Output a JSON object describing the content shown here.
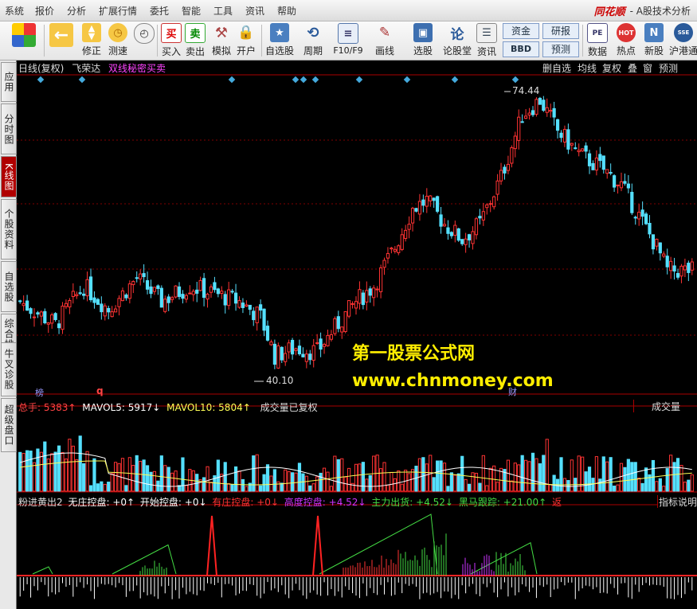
{
  "menu": [
    "系统",
    "报价",
    "分析",
    "扩展行情",
    "委托",
    "智能",
    "工具",
    "资讯",
    "帮助"
  ],
  "brand": {
    "logo": "同花顺",
    "title": "- A股技术分析"
  },
  "toolbar": [
    {
      "label": "",
      "icon": "layout-icon"
    },
    {
      "label": "",
      "icon": "back-arrow-icon"
    },
    {
      "label": "修正",
      "icon": "arrow-updown-icon"
    },
    {
      "label": "测速",
      "icon": "clock-icon"
    },
    {
      "label": "买入",
      "glyph": "买"
    },
    {
      "label": "卖出",
      "glyph": "卖"
    },
    {
      "label": "模拟",
      "icon": "hammer-icon"
    },
    {
      "label": "开户",
      "icon": "lock-icon"
    },
    {
      "label": "自选股",
      "icon": "star-folder-icon"
    },
    {
      "label": "周期",
      "icon": "cycle-icon"
    },
    {
      "label": "F10/F9",
      "icon": "doc-icon"
    },
    {
      "label": "画线",
      "icon": "pen-icon"
    },
    {
      "label": "选股",
      "icon": "screen-icon"
    },
    {
      "label": "论股堂",
      "glyph": "论"
    },
    {
      "label": "资讯",
      "icon": "news-icon"
    },
    {
      "label": "资金",
      "small": true
    },
    {
      "label": "BBD",
      "small": true
    },
    {
      "label": "研报",
      "small": true
    },
    {
      "label": "预测",
      "small": true
    },
    {
      "label": "数据",
      "glyph": "PE"
    },
    {
      "label": "热点",
      "glyph": "HOT"
    },
    {
      "label": "新股",
      "glyph": "N"
    },
    {
      "label": "沪港通",
      "glyph": "SSE"
    }
  ],
  "sidebar": [
    "应用",
    "分时图",
    "K线图",
    "个股资料",
    "自选股",
    "综合排名",
    "牛叉诊股",
    "超级盘口"
  ],
  "sidebar_active": 2,
  "header": {
    "period": "日线(复权)",
    "stock": "飞荣达",
    "formula": "双线秘密买卖"
  },
  "right_buttons": [
    "删自选",
    "均线",
    "复权",
    "叠",
    "窗",
    "预测"
  ],
  "price": {
    "high_label": "74.44",
    "low_label": "40.10",
    "high": 74.44,
    "low": 40.1
  },
  "markers": {
    "bang": "榜",
    "q": "q",
    "cai": "财"
  },
  "watermark": {
    "line1": "第一股票公式网",
    "line2": "www.chnmoney.com"
  },
  "volume_header": {
    "total": "总手: 5383↑",
    "ma5": "MAVOL5: 5917↓",
    "ma10": "MAVOL10: 5804↑",
    "note": "成交量已复权",
    "tab": "成交量"
  },
  "indicator_header": {
    "name": "粉进黄出2",
    "items": [
      {
        "text": "无庄控盘: +0↑",
        "color": "#ffffff"
      },
      {
        "text": "开始控盘: +0↓",
        "color": "#ffffff"
      },
      {
        "text": "有庄控盘: +0↓",
        "color": "#ff3333"
      },
      {
        "text": "高度控盘: +4.52↓",
        "color": "#cc33ff"
      },
      {
        "text": "主力出货: +4.52↓",
        "color": "#44dd44"
      },
      {
        "text": "黑马跟踪: +21.00↑",
        "color": "#44dd44"
      },
      {
        "text": "返",
        "color": "#ff3333"
      }
    ],
    "tab": "指标说明"
  },
  "colors": {
    "up": "#ff3333",
    "down": "#55e0ff",
    "grid": "#7a0000",
    "bg": "#000000",
    "marker": "#44aadd"
  }
}
